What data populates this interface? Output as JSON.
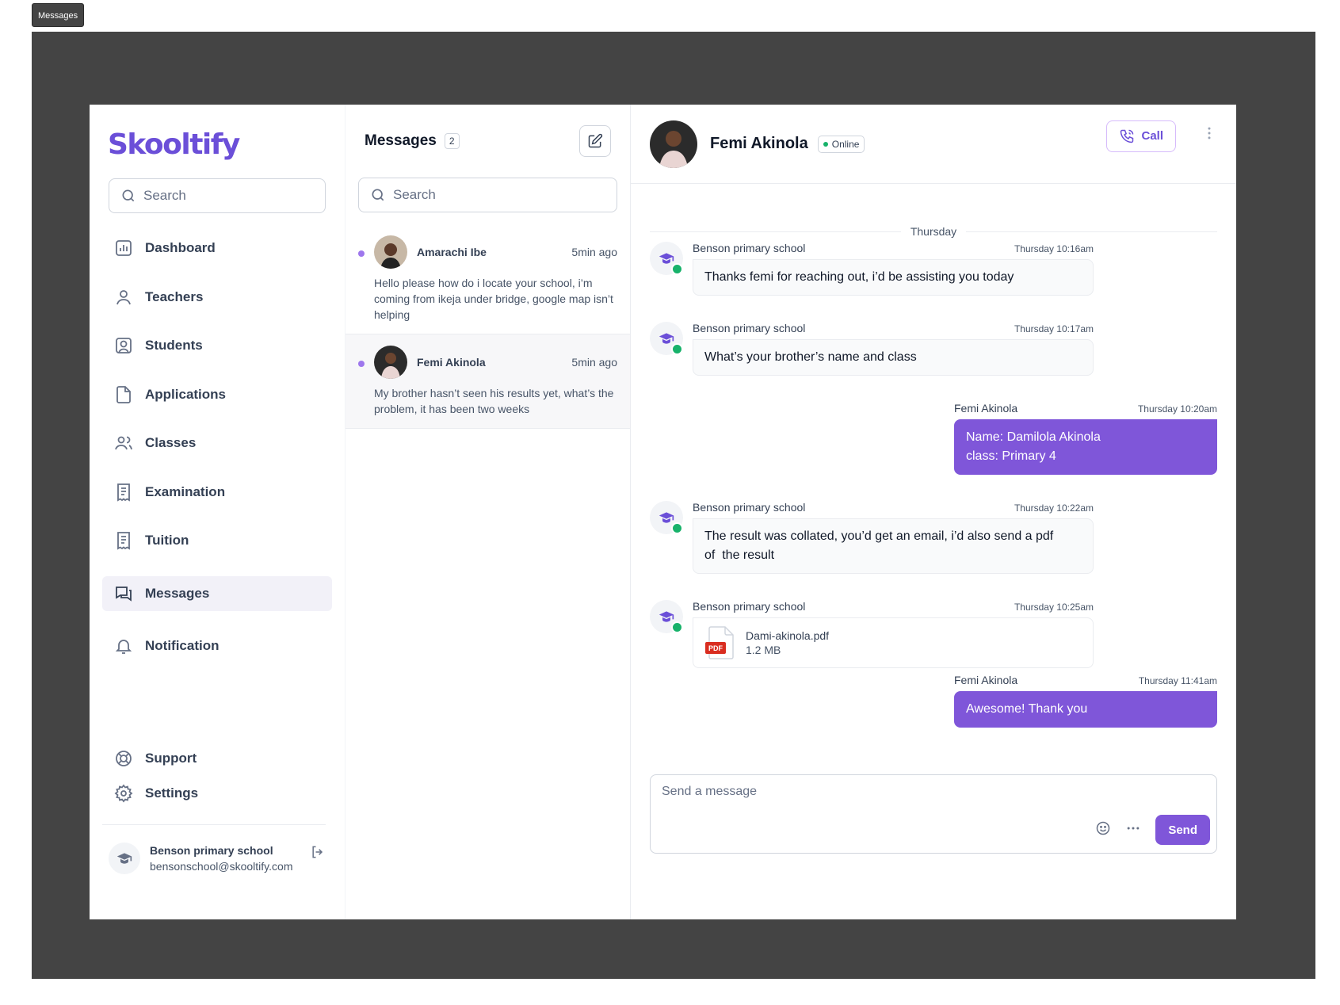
{
  "frame_label": "Messages",
  "sidebar": {
    "logo": "Skooltify",
    "search_placeholder": "Search",
    "items": [
      {
        "label": "Dashboard",
        "icon": "bar-chart-icon"
      },
      {
        "label": "Teachers",
        "icon": "user-icon"
      },
      {
        "label": "Students",
        "icon": "user-square-icon"
      },
      {
        "label": "Applications",
        "icon": "file-icon"
      },
      {
        "label": "Classes",
        "icon": "users-icon"
      },
      {
        "label": "Examination",
        "icon": "receipt-icon"
      },
      {
        "label": "Tuition",
        "icon": "receipt-icon"
      },
      {
        "label": "Messages",
        "icon": "messages-icon"
      },
      {
        "label": "Notification",
        "icon": "bell-icon"
      }
    ],
    "active": "Messages",
    "support_label": "Support",
    "settings_label": "Settings",
    "profile": {
      "name": "Benson primary school",
      "email": "bensonschool@skooltify.com"
    }
  },
  "list": {
    "title": "Messages",
    "count": "2",
    "search_placeholder": "Search",
    "threads": [
      {
        "name": "Amarachi Ibe",
        "time": "5min ago",
        "preview": "Hello please how do i locate your school, i’m coming from ikeja under bridge, google map isn’t helping",
        "unread": true
      },
      {
        "name": "Femi Akinola",
        "time": "5min ago",
        "preview": "My brother hasn’t seen his results yet, what’s the problem, it has been two weeks",
        "unread": true
      }
    ]
  },
  "chat": {
    "contact_name": "Femi Akinola",
    "status": "Online",
    "call_label": "Call",
    "day_divider": "Thursday",
    "messages": [
      {
        "sender": "Benson primary school",
        "time": "Thursday 10:16am",
        "text": "Thanks femi for reaching out, i’d be assisting you today"
      },
      {
        "sender": "Benson primary school",
        "time": "Thursday 10:17am",
        "text": "What’s your brother’s name and class"
      },
      {
        "sender": "Femi Akinola",
        "time": "Thursday 10:20am",
        "line1": "Name: Damilola Akinola",
        "line2": "class: Primary 4"
      },
      {
        "sender": "Benson primary school",
        "time": "Thursday 10:22am",
        "line1": "The result was collated, you’d get an email, i’d also send a pdf",
        "line2": "of  the result"
      },
      {
        "sender": "Benson primary school",
        "time": "Thursday 10:25am",
        "file_name": "Dami-akinola.pdf",
        "file_size": "1.2 MB",
        "file_badge": "PDF"
      },
      {
        "sender": "Femi Akinola",
        "time": "Thursday 11:41am",
        "text": "Awesome! Thank you"
      }
    ],
    "composer_placeholder": "Send a message",
    "send_label": "Send"
  },
  "colors": {
    "accent": "#7f56d9",
    "logo": "#6b4fd8",
    "online": "#17b26a",
    "backdrop": "#444444"
  }
}
